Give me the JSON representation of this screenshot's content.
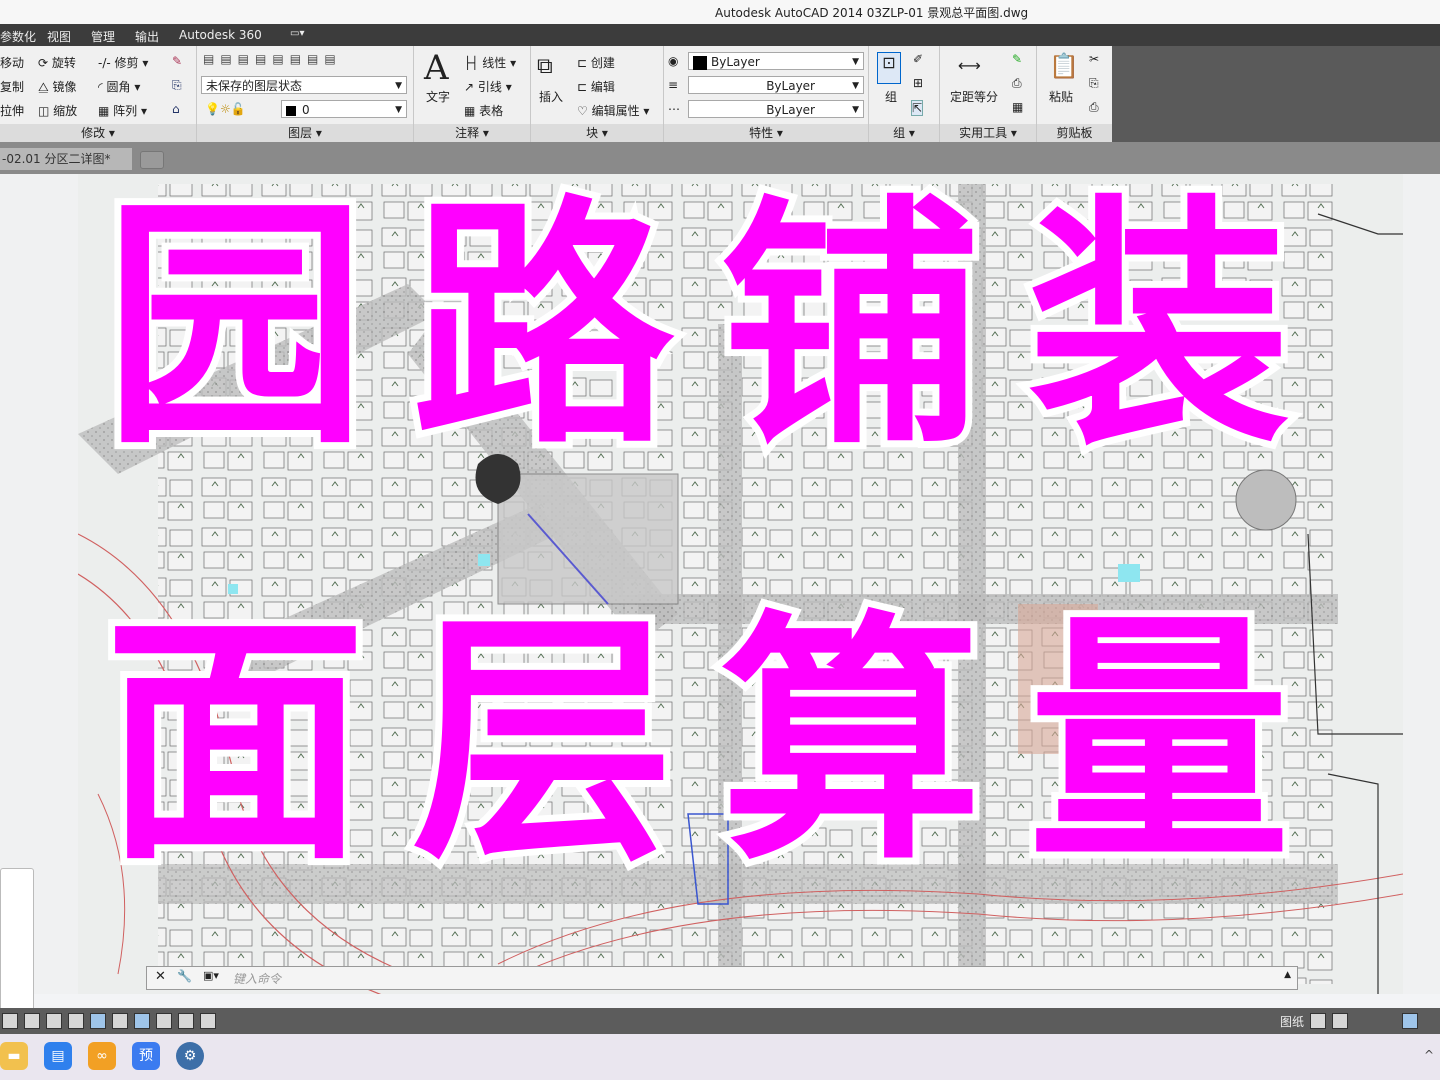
{
  "window": {
    "title": "Autodesk AutoCAD 2014    03ZLP-01 景观总平面图.dwg"
  },
  "menu": [
    "参数化",
    "视图",
    "管理",
    "输出",
    "Autodesk 360"
  ],
  "ribbon": {
    "modify": {
      "title": "修改 ▾",
      "items": [
        "移动",
        "旋转",
        "修剪",
        "复制",
        "镜像",
        "圆角",
        "拉伸",
        "缩放",
        "阵列"
      ]
    },
    "layers": {
      "title": "图层 ▾",
      "state_combo": "未保存的图层状态",
      "layer_combo": "0"
    },
    "annotation": {
      "title": "注释 ▾",
      "text": "文字",
      "linear": "线性",
      "leader": "引线",
      "table": "表格"
    },
    "block": {
      "title": "块 ▾",
      "insert": "插入",
      "create": "创建",
      "edit": "编辑",
      "edit_attr": "编辑属性"
    },
    "properties": {
      "title": "特性 ▾",
      "color": "ByLayer",
      "linetype": "ByLayer",
      "lineweight": "ByLayer"
    },
    "groups": {
      "title": "组 ▾",
      "group": "组"
    },
    "utilities": {
      "title": "实用工具 ▾",
      "measure": "定距等分"
    },
    "clipboard": {
      "title": "剪贴板",
      "paste": "粘贴"
    }
  },
  "doc_tab": {
    "label": "-02.01 分区二详图*"
  },
  "command_line": {
    "placeholder": "键入命令"
  },
  "status": {
    "paper": "图纸"
  },
  "overlay": {
    "line1": "园路铺装",
    "line2": "面层算量",
    "color": "#ff00ff"
  },
  "taskbar": {
    "apps": [
      "folder-icon",
      "app-icon-1",
      "app-icon-2",
      "preview-icon",
      "settings-icon"
    ],
    "preview_label": "预"
  }
}
